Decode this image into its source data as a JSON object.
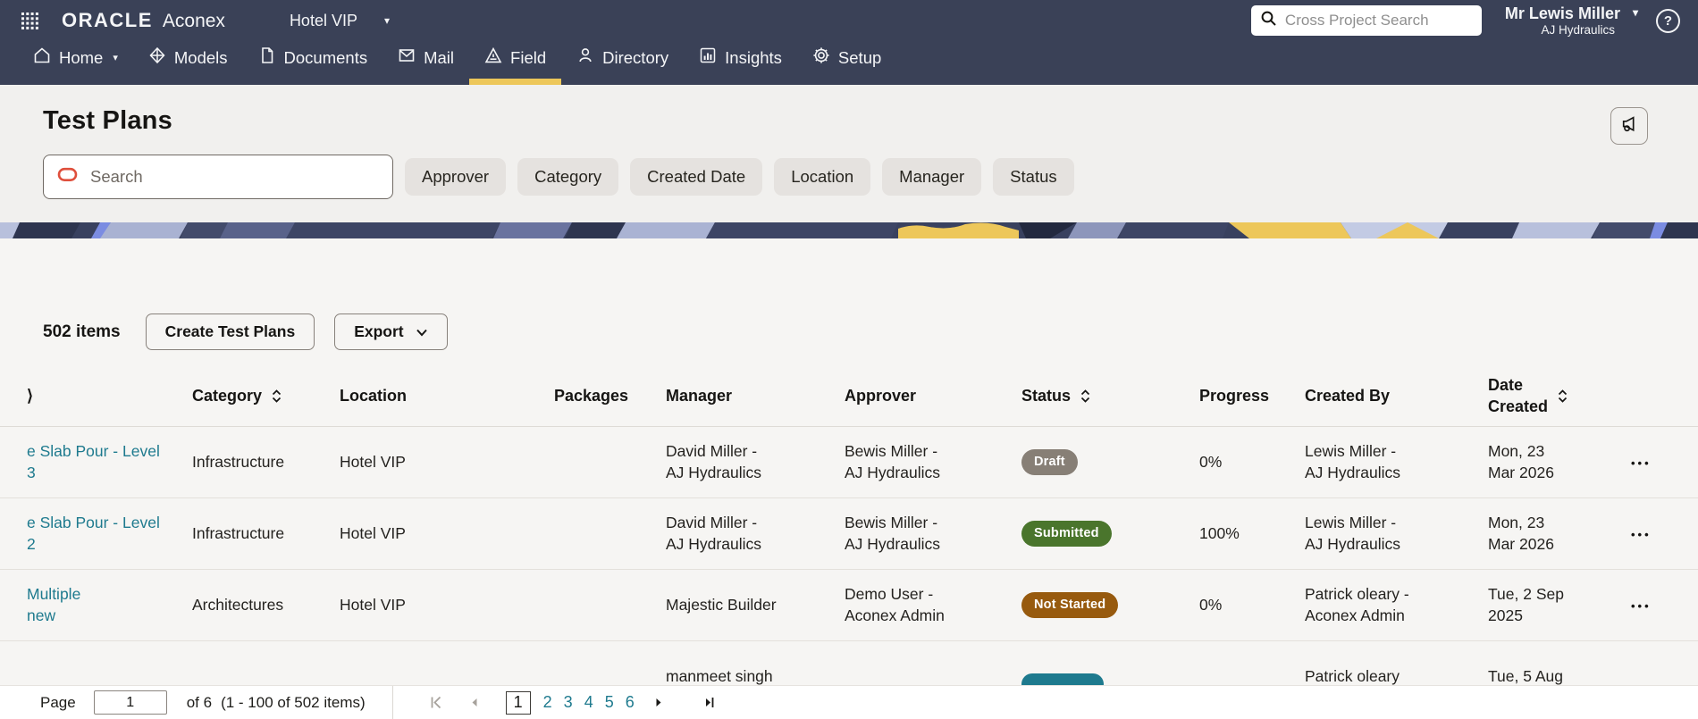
{
  "topbar": {
    "brand_oracle": "ORACLE",
    "brand_product": "Aconex",
    "project_name": "Hotel VIP",
    "search_placeholder": "Cross Project Search",
    "user_name": "Mr Lewis Miller",
    "user_org": "AJ Hydraulics",
    "help_label": "?",
    "nav": [
      {
        "label": "Home",
        "icon": "home-icon",
        "active": false
      },
      {
        "label": "Models",
        "icon": "models-icon",
        "active": false
      },
      {
        "label": "Documents",
        "icon": "document-icon",
        "active": false
      },
      {
        "label": "Mail",
        "icon": "mail-icon",
        "active": false
      },
      {
        "label": "Field",
        "icon": "field-icon",
        "active": true
      },
      {
        "label": "Directory",
        "icon": "directory-icon",
        "active": false
      },
      {
        "label": "Insights",
        "icon": "insights-icon",
        "active": false
      },
      {
        "label": "Setup",
        "icon": "setup-icon",
        "active": false
      }
    ]
  },
  "page": {
    "title": "Test Plans",
    "search_placeholder": "Search",
    "filters": [
      "Approver",
      "Category",
      "Created Date",
      "Location",
      "Manager",
      "Status"
    ]
  },
  "toolbar": {
    "count": "502 items",
    "create": "Create Test Plans",
    "export": "Export"
  },
  "icons": {
    "caret_down": "▾",
    "row_actions": "•••",
    "truncated_header": "⟩"
  },
  "colors": {
    "accent_yellow": "#edc75a",
    "topbar_navy": "#3a4157",
    "link_teal": "#1e7a8e",
    "badge_draft": "#877f76",
    "badge_submitted": "#4a752c",
    "badge_not_started": "#975a0e",
    "badge_partial": "#1e7a8e"
  },
  "table": {
    "headers": {
      "col0": "⟩",
      "category": "Category",
      "location": "Location",
      "packages": "Packages",
      "manager": "Manager",
      "approver": "Approver",
      "status": "Status",
      "progress": "Progress",
      "created_by": "Created By",
      "date_created": "Date\nCreated",
      "actions": ""
    },
    "rows": [
      {
        "name": "e Slab Pour - Level\n3",
        "category": "Infrastructure",
        "location": "Hotel VIP",
        "packages": "",
        "manager": "David Miller -\nAJ Hydraulics",
        "approver": "Bewis Miller -\nAJ Hydraulics",
        "status": "Draft",
        "status_style": "background:#877f76",
        "progress": "0%",
        "created_by": "Lewis Miller -\nAJ Hydraulics",
        "date_created": "Mon, 23\nMar 2026"
      },
      {
        "name": "e Slab Pour - Level\n2",
        "category": "Infrastructure",
        "location": "Hotel VIP",
        "packages": "",
        "manager": "David Miller -\nAJ Hydraulics",
        "approver": "Bewis Miller -\nAJ Hydraulics",
        "status": "Submitted",
        "status_style": "background:#4a752c",
        "progress": "100%",
        "created_by": "Lewis Miller -\nAJ Hydraulics",
        "date_created": "Mon, 23\nMar 2026"
      },
      {
        "name": "Multiple\nnew",
        "category": "Architectures",
        "location": "Hotel VIP",
        "packages": "",
        "manager": "Majestic Builder",
        "approver": "Demo User -\nAconex Admin",
        "status": "Not Started",
        "status_style": "background:#975a0e",
        "progress": "0%",
        "created_by": "Patrick oleary -\nAconex Admin",
        "date_created": "Tue, 2 Sep\n2025"
      },
      {
        "name": "",
        "category": "",
        "location": "",
        "packages": "",
        "manager": "manmeet singh",
        "approver": "",
        "status": "",
        "status_style": "background:#1e7a8e",
        "progress": "",
        "created_by": "Patrick oleary",
        "date_created": "Tue, 5 Aug"
      }
    ]
  },
  "pagination": {
    "page_label": "Page",
    "page_value": "1",
    "of_label": "of 6",
    "range_label": "(1 - 100 of 502 items)",
    "current": "1",
    "pages": [
      "2",
      "3",
      "4",
      "5",
      "6"
    ]
  }
}
